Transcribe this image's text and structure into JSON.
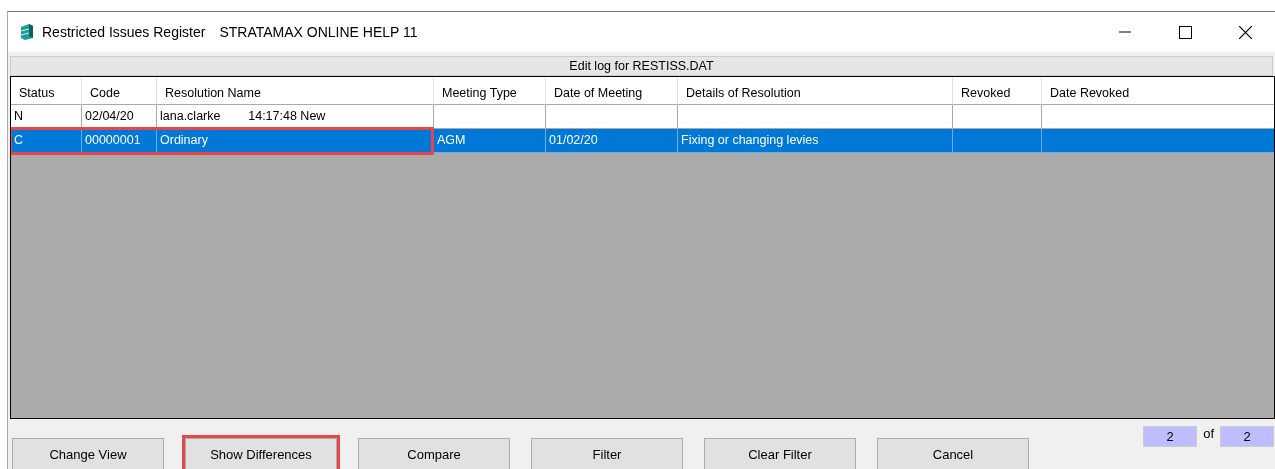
{
  "window": {
    "title": "Restricted Issues Register",
    "subtitle": "STRATAMAX ONLINE HELP  11"
  },
  "log_header": "Edit log for RESTISS.DAT",
  "table": {
    "columns": [
      "Status",
      "Code",
      "Resolution Name",
      "Meeting Type",
      "Date of Meeting",
      "Details of Resolution",
      "Revoked",
      "Date Revoked"
    ],
    "rows": [
      {
        "cells": [
          "N",
          "02/04/20",
          "lana.clarke        14:17:48 New",
          "",
          "",
          "",
          "",
          ""
        ],
        "selected": false,
        "annotated": false
      },
      {
        "cells": [
          "C",
          "00000001",
          "Ordinary",
          "AGM",
          "01/02/20",
          "Fixing or changing levies",
          "",
          ""
        ],
        "selected": true,
        "annotated": true
      }
    ]
  },
  "buttons": [
    {
      "label": "Change View",
      "annotated": false
    },
    {
      "label": "Show Differences",
      "annotated": true
    },
    {
      "label": "Compare",
      "annotated": false
    },
    {
      "label": "Filter",
      "annotated": false
    },
    {
      "label": "Clear Filter",
      "annotated": false
    },
    {
      "label": "Cancel",
      "annotated": false
    }
  ],
  "pager": {
    "current": "2",
    "separator": "of",
    "total": "2"
  }
}
